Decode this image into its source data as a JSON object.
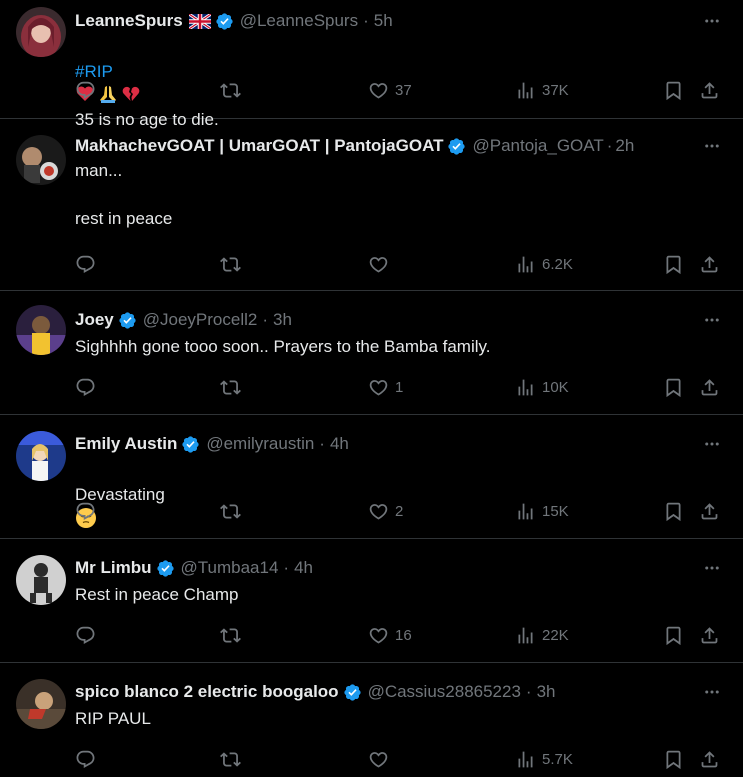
{
  "tweets": [
    {
      "name": "LeanneSpurs",
      "has_flag": true,
      "handle": "@LeanneSpurs",
      "time": "5h",
      "hashtag": "#RIP",
      "text_after_emoji": "35 is no age to die.",
      "emojis": [
        "red-heart-emoji",
        "folded-hands-emoji",
        "broken-heart-emoji"
      ],
      "replies": "",
      "likes": "37",
      "views": "37K"
    },
    {
      "name": "MakhachevGOAT | UmarGOAT | PantojaGOAT",
      "handle": "@Pantoja_GOAT",
      "time": "2h",
      "text": "man...\n\nrest in peace",
      "replies": "",
      "likes": "",
      "views": "6.2K"
    },
    {
      "name": "Joey",
      "handle": "@JoeyProcell2",
      "time": "3h",
      "text": "Sighhhh gone tooo soon.. Prayers to the Bamba family.",
      "replies": "",
      "likes": "1",
      "views": "10K"
    },
    {
      "name": "Emily Austin",
      "handle": "@emilyraustin",
      "time": "4h",
      "text": "Devastating",
      "emoji": "pensive-face-emoji",
      "replies": "",
      "likes": "2",
      "views": "15K"
    },
    {
      "name": "Mr Limbu",
      "handle": "@Tumbaa14",
      "time": "4h",
      "text": "Rest in peace Champ",
      "replies": "",
      "likes": "16",
      "views": "22K"
    },
    {
      "name": "spico blanco 2 electric boogaloo",
      "handle": "@Cassius28865223",
      "time": "3h",
      "text": "RIP PAUL",
      "replies": "",
      "likes": "",
      "views": "5.7K"
    }
  ],
  "separator": "·",
  "colors": {
    "background": "#000000",
    "text": "#e7e9ea",
    "muted": "#71767b",
    "accent": "#1d9bf0",
    "divider": "#2f3336"
  }
}
